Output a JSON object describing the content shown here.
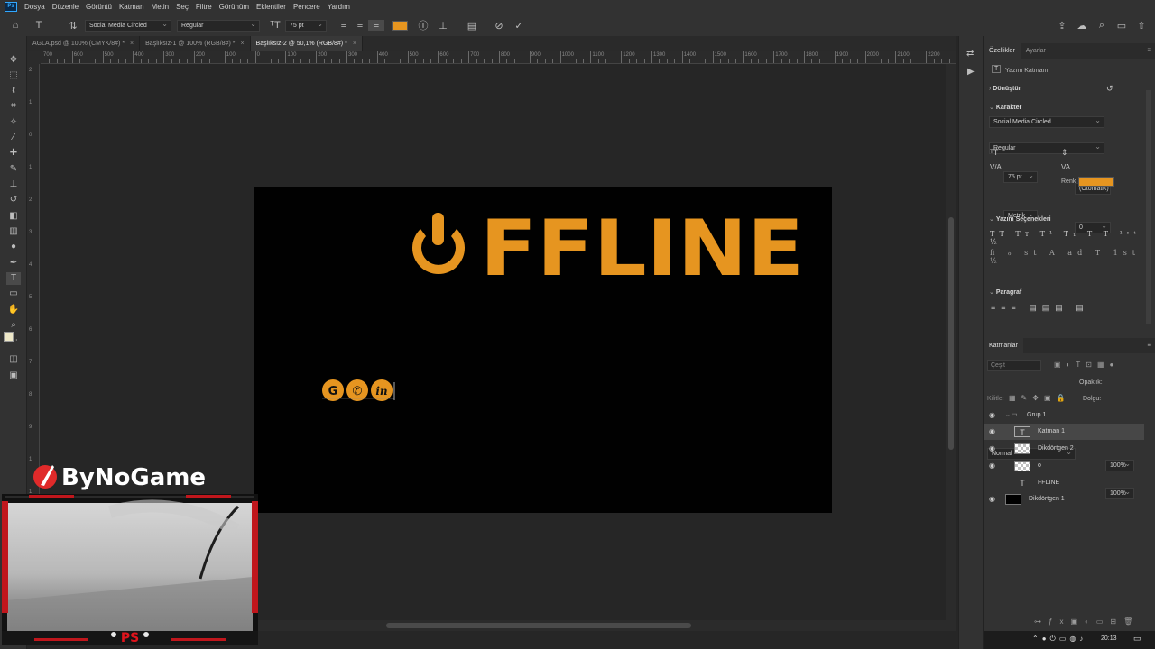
{
  "menu": {
    "logo": "Ps",
    "items": [
      "Dosya",
      "Düzenle",
      "Görüntü",
      "Katman",
      "Metin",
      "Seç",
      "Filtre",
      "Görünüm",
      "Eklentiler",
      "Pencere",
      "Yardım"
    ]
  },
  "options_bar": {
    "font_family": "Social Media Circled",
    "font_style": "Regular",
    "font_size": "75 pt",
    "text_color": "#e69520"
  },
  "tabs": [
    {
      "label": "AGLA.psd @ 100% (CMYK/8#) *",
      "active": false
    },
    {
      "label": "Başlıksız-1 @ 100% (RGB/8#) *",
      "active": false
    },
    {
      "label": "Başlıksız-2 @ 50,1% (RGB/8#) *",
      "active": true
    }
  ],
  "ruler": {
    "h_labels": [
      "700",
      "600",
      "500",
      "400",
      "300",
      "200",
      "100",
      "0",
      "100",
      "200",
      "300",
      "400",
      "500",
      "600",
      "700",
      "800",
      "900",
      "1000",
      "1100",
      "1200",
      "1300",
      "1400",
      "1500",
      "1600",
      "1700",
      "1800",
      "1900",
      "2000",
      "2100",
      "2200"
    ],
    "v_labels": [
      "2",
      "1",
      "0",
      "1",
      "2",
      "3",
      "4",
      "5",
      "6",
      "7",
      "8",
      "9",
      "1",
      "1",
      "1",
      "1"
    ]
  },
  "canvas": {
    "headline": "OFFLINE",
    "headline_color": "#e69520",
    "icons_text": "G ☏ in",
    "artboard_color": "#000000"
  },
  "overlay": {
    "brand": "ByNoGame",
    "webcam_logo": "PS"
  },
  "properties": {
    "tabs": [
      "Özellikler",
      "Ayarlar"
    ],
    "layer_kind": "Yazım Katmanı",
    "sections": {
      "transform": "Dönüştür",
      "character": "Karakter",
      "type_options": "Yazım Seçenekleri",
      "paragraph": "Paragraf"
    },
    "font_family": "Social Media Circled",
    "font_style": "Regular",
    "font_size": "75 pt",
    "leading": "(Otomatik)",
    "kerning": "Metrik",
    "tracking": "0",
    "color_label": "Renk",
    "color": "#e69520"
  },
  "layers": {
    "title": "Katmanlar",
    "search_placeholder": "Çeşit",
    "blend_mode": "Normal",
    "opacity_label": "Opaklık:",
    "opacity": "100%",
    "lock_label": "Kilitle:",
    "fill_label": "Dolgu:",
    "fill": "100%",
    "items": [
      {
        "name": "Grup 1",
        "type": "group"
      },
      {
        "name": "Katman 1",
        "type": "text",
        "selected": true
      },
      {
        "name": "Dikdörtgen 2",
        "type": "shape"
      },
      {
        "name": "o",
        "type": "pixel"
      },
      {
        "name": "FFLINE",
        "type": "text"
      },
      {
        "name": "Dikdörtgen 1",
        "type": "shape-black"
      }
    ]
  },
  "taskbar": {
    "time": "20:13"
  }
}
